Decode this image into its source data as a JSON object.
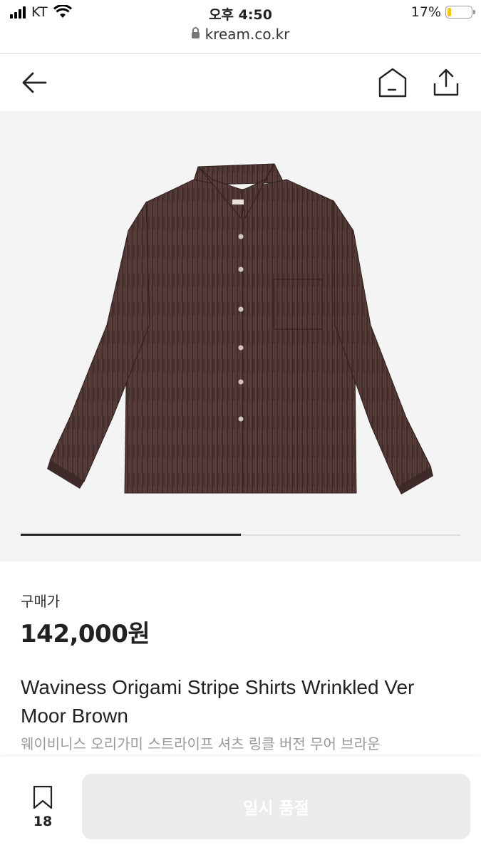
{
  "status_bar": {
    "carrier": "KT",
    "time": "오후 4:50",
    "battery_percent": "17%",
    "battery_level": 0.17,
    "battery_color": "#f5c518"
  },
  "url_bar": {
    "domain": "kream.co.kr",
    "icon": "lock-icon"
  },
  "nav": {
    "back_icon": "back-arrow-icon",
    "home_icon": "home-icon",
    "share_icon": "share-icon"
  },
  "gallery": {
    "image": "brown-striped-shirt",
    "progress": 0.5
  },
  "product": {
    "price_label": "구매가",
    "price": "142,000원",
    "title": "Waviness Origami Stripe Shirts Wrinkled Ver Moor Brown",
    "subtitle": "웨이비니스 오리가미 스트라이프 셔츠 링클 버전 무어 브라운"
  },
  "bottom_bar": {
    "wish_icon": "bookmark-icon",
    "wish_count": "18",
    "action_label": "일시 품절"
  }
}
